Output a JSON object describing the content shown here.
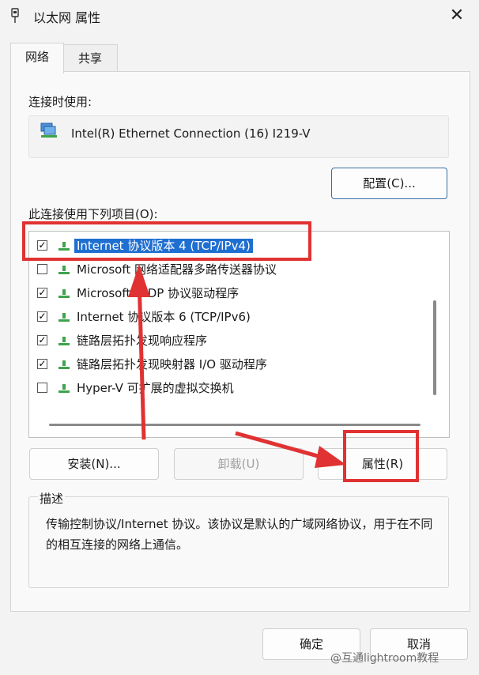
{
  "window": {
    "title": "以太网 属性",
    "close_glyph": "✕",
    "icon": "network-adapter-icon"
  },
  "tabs": [
    {
      "label": "网络",
      "active": true
    },
    {
      "label": "共享",
      "active": false
    }
  ],
  "connect_using": {
    "label": "连接时使用:",
    "adapter_name": "Intel(R) Ethernet Connection (16) I219-V",
    "configure_button": "配置(C)..."
  },
  "items_section": {
    "label": "此连接使用下列项目(O):",
    "items": [
      {
        "label": "Internet 协议版本 4 (TCP/IPv4)",
        "checked": true,
        "selected": true
      },
      {
        "label": "Microsoft 网络适配器多路传送器协议",
        "checked": false,
        "selected": false
      },
      {
        "label": "Microsoft LLDP 协议驱动程序",
        "checked": true,
        "selected": false
      },
      {
        "label": "Internet 协议版本 6 (TCP/IPv6)",
        "checked": true,
        "selected": false
      },
      {
        "label": "链路层拓扑发现响应程序",
        "checked": true,
        "selected": false
      },
      {
        "label": "链路层拓扑发现映射器 I/O 驱动程序",
        "checked": true,
        "selected": false
      },
      {
        "label": "Hyper-V 可扩展的虚拟交换机",
        "checked": false,
        "selected": false
      }
    ]
  },
  "actions": {
    "install": "安装(N)...",
    "uninstall": "卸载(U)",
    "properties": "属性(R)"
  },
  "description": {
    "title": "描述",
    "text": "传输控制协议/Internet 协议。该协议是默认的广域网络协议，用于在不同的相互连接的网络上通信。"
  },
  "footer": {
    "ok": "确定",
    "cancel": "取消"
  },
  "watermark": "@互通lightroom教程",
  "colors": {
    "highlight": "#e03232",
    "selection": "#1f6fd1"
  }
}
